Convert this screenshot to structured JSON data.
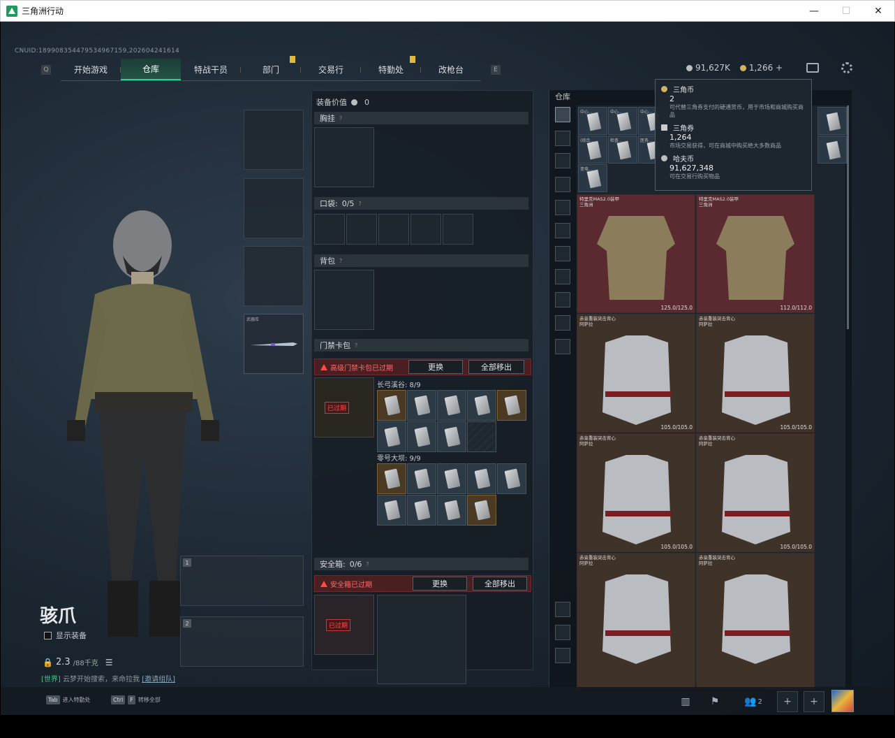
{
  "window": {
    "title": "三角洲行动",
    "min": "—",
    "max": "☐",
    "close": "✕"
  },
  "cnuid": "CNUID:18990835447953496715​9,20260424​1614",
  "nav": {
    "key_left": "Q",
    "key_right": "E",
    "tabs": [
      "开始游戏",
      "仓库",
      "特战干员",
      "部门",
      "交易行",
      "特勤处",
      "改枪台"
    ],
    "active": "仓库"
  },
  "currency": {
    "hafu": "91,627K",
    "ticket": "1,266",
    "plus": "+"
  },
  "tooltip": {
    "coin_name": "三角币",
    "coin_value": "2",
    "coin_desc": "可代替三角券支付的硬通货币，用于市场和商城购买商品",
    "ticket_name": "三角券",
    "ticket_value": "1,264",
    "ticket_desc": "市场交易获得，可在商城中购买绝大多数商品",
    "hafu_name": "哈夫币",
    "hafu_value": "91,627,348",
    "hafu_desc": "可在交易行购买物品"
  },
  "character": {
    "name": "骇爪",
    "show_equip": "显示装备",
    "weight": "2.3",
    "weight_max": "/88千克"
  },
  "chat": {
    "world": "[世界]",
    "text": "云梦开始搜索，来命拉我",
    "invite": "[邀请组队]"
  },
  "weapon_slot_label": "武器库",
  "slots": {
    "slot1": "1",
    "slot2": "2"
  },
  "equipment": {
    "value_label": "装备价值",
    "value": "0",
    "chest_rig": "胸挂",
    "pocket": "口袋:",
    "pocket_count": "0/5",
    "backpack": "背包",
    "keycard": "门禁卡包",
    "keycard_warn": "高级门禁卡包已过期",
    "replace": "更换",
    "remove_all": "全部移出",
    "group1": "长弓溪谷: 8/9",
    "group2": "零号大坝: 9/9",
    "keycard_expired": "已过期",
    "safebox": "安全箱:",
    "safebox_count": "0/6",
    "safebox_warn": "安全箱已过期",
    "safebox_expired": "已过期"
  },
  "stash": {
    "title": "仓库",
    "armor": [
      {
        "name": "特里克MAS2.0装甲",
        "sub": "三角洲",
        "dura": "125.0/125.0",
        "type": "red"
      },
      {
        "name": "特里克MAS2.0装甲",
        "sub": "三角洲",
        "dura": "112.0/112.0",
        "type": "red"
      },
      {
        "name": "赤枭重装突击背心",
        "sub": "阿萨拉",
        "dura": "105.0/105.0",
        "type": "brown"
      },
      {
        "name": "赤枭重装突击背心",
        "sub": "阿萨拉",
        "dura": "105.0/105.0",
        "type": "brown"
      },
      {
        "name": "赤枭重装突击背心",
        "sub": "阿萨拉",
        "dura": "105.0/105.0",
        "type": "brown"
      },
      {
        "name": "赤枭重装突击背心",
        "sub": "阿萨拉",
        "dura": "105.0/105.0",
        "type": "brown"
      },
      {
        "name": "赤枭重装突击背心",
        "sub": "阿萨拉",
        "dura": "",
        "type": "brown"
      },
      {
        "name": "赤枭重装突击背心",
        "sub": "阿萨拉",
        "dura": "",
        "type": "brown"
      }
    ],
    "small_tags": [
      "中心...",
      "中心...",
      "中心...",
      "(综合...",
      "检查...",
      "医务...",
      "变电..."
    ]
  },
  "bottom": {
    "hint1_key": "Tab",
    "hint1": "进入特勤处",
    "hint2_key1": "Ctrl",
    "hint2_key2": "F",
    "hint2": "转移全部",
    "friends": "2"
  },
  "colors": {
    "accent": "#2fd09a",
    "warn": "#ff4a4a",
    "badge": "#e0b93a"
  }
}
